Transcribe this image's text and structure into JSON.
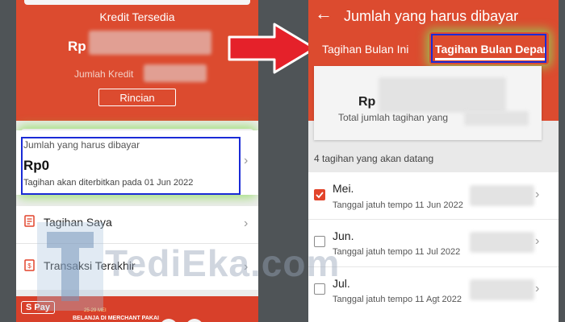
{
  "left": {
    "credit_label": "Kredit Tersedia",
    "amount_prefix": "Rp",
    "limit_label": "Jumlah Kredit",
    "detail_button": "Rincian",
    "due_card": {
      "title": "Jumlah yang harus dibayar",
      "amount": "Rp0",
      "note": "Tagihan akan diterbitkan pada 01 Jun 2022"
    },
    "menu": [
      {
        "label": "Tagihan Saya",
        "icon": "document-icon"
      },
      {
        "label": "Transaksi Terakhir",
        "icon": "receipt-icon"
      }
    ],
    "banner": {
      "brand": "S Pay",
      "date": "25-29 MEI",
      "text": "BELANJA DI MERCHANT PAKAI"
    }
  },
  "right": {
    "header_title": "Jumlah yang harus dibayar",
    "tabs": [
      {
        "label": "Tagihan Bulan Ini",
        "active": false
      },
      {
        "label": "Tagihan Bulan Depan",
        "active": true
      }
    ],
    "summary": {
      "amount_prefix": "Rp",
      "label": "Total jumlah tagihan yang"
    },
    "bills_header": "4 tagihan yang akan datang",
    "bills": [
      {
        "month": "Mei.",
        "due": "Tanggal jatuh tempo 11 Jun 2022",
        "checked": true
      },
      {
        "month": "Jun.",
        "due": "Tanggal jatuh tempo 11 Jul 2022",
        "checked": false
      },
      {
        "month": "Jul.",
        "due": "Tanggal jatuh tempo 11 Agt 2022",
        "checked": false
      }
    ]
  },
  "watermark": "TediEka.com",
  "colors": {
    "accent": "#e2442b",
    "highlight": "#1a2bd6",
    "glow": "#8cdc5a",
    "arrow": "#e5212a"
  }
}
